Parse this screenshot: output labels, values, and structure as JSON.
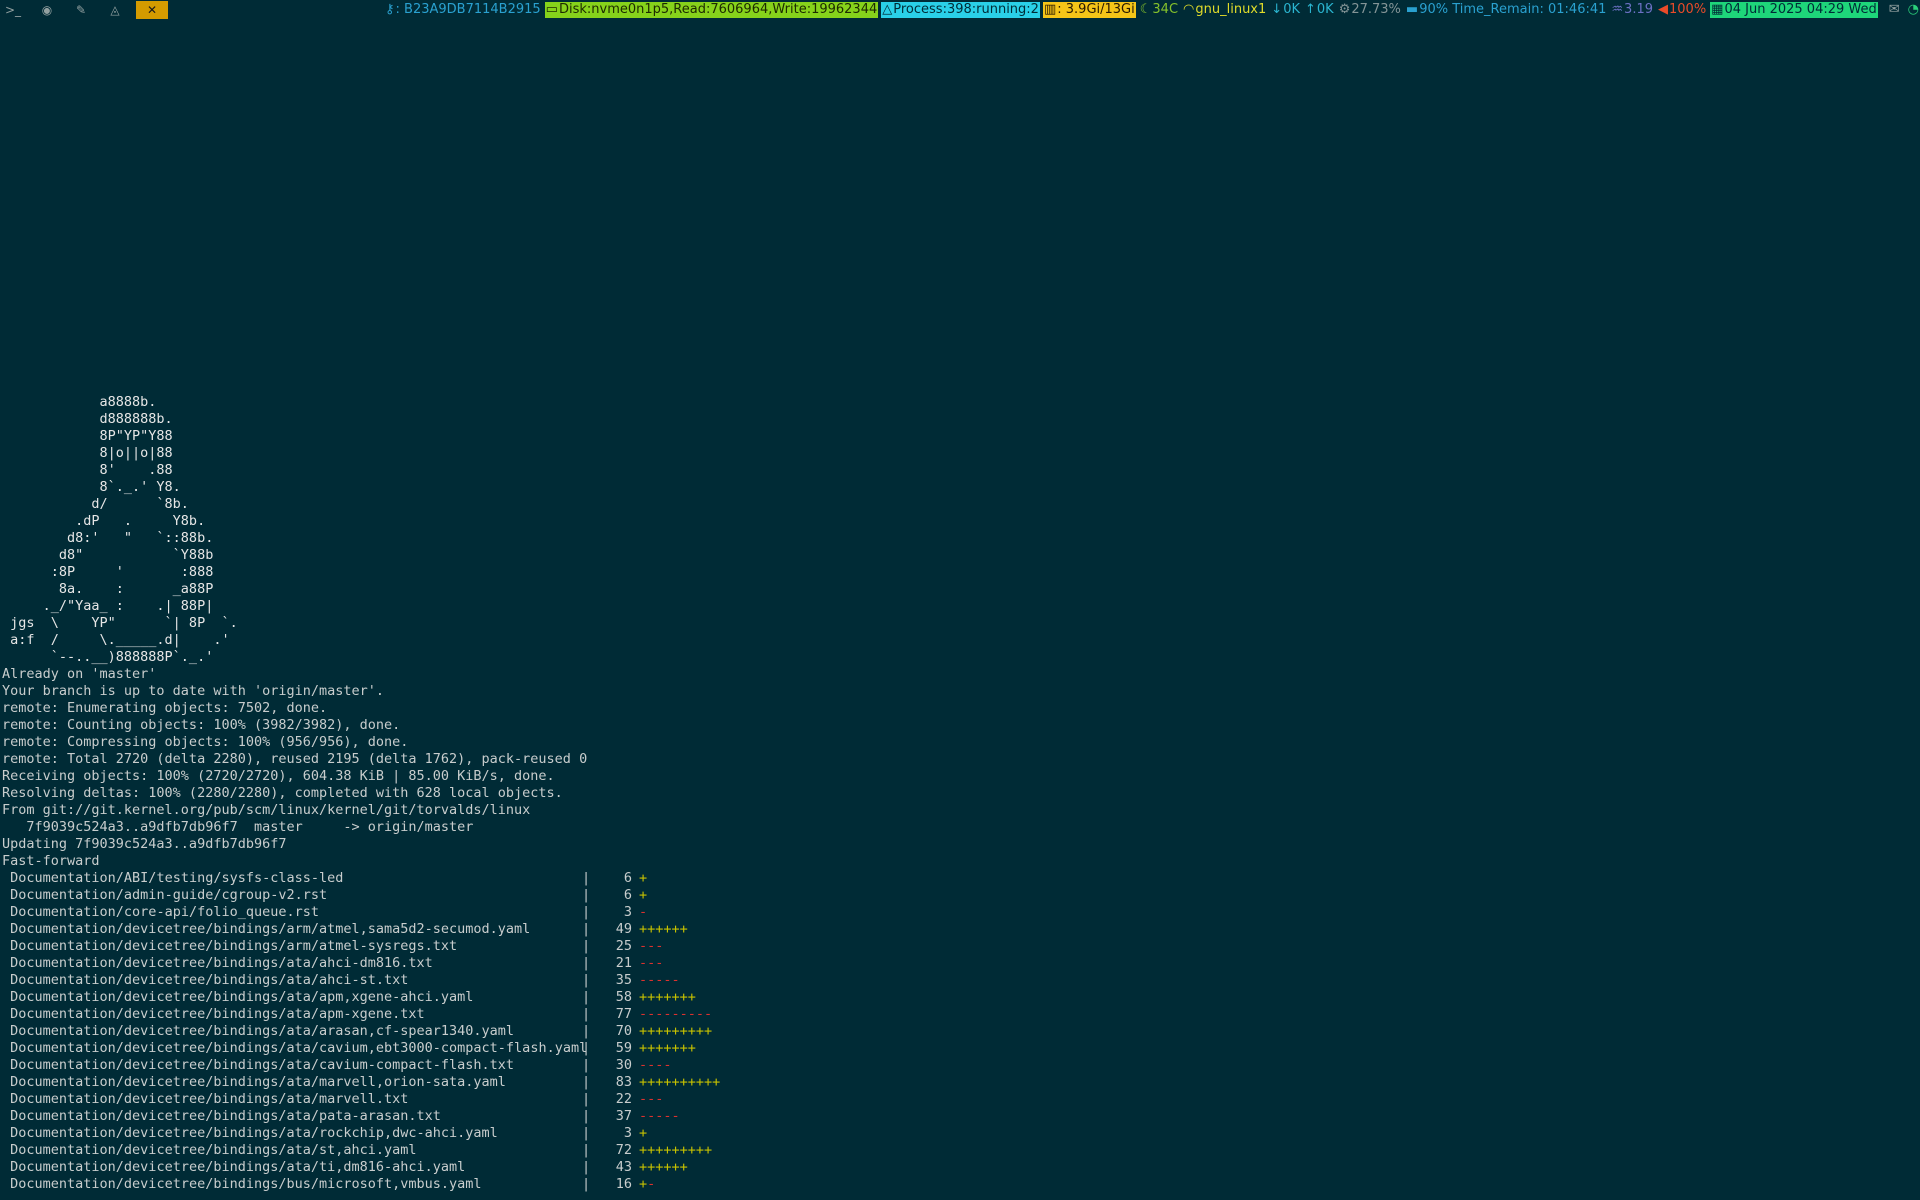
{
  "statusbar": {
    "tags": [
      {
        "name": "terminal-tag",
        "glyph": ">_"
      },
      {
        "name": "browser-tag",
        "glyph": "◉"
      },
      {
        "name": "editor-tag",
        "glyph": "✎"
      },
      {
        "name": "linux-tag",
        "glyph": "◬"
      },
      {
        "name": "tools-tag",
        "glyph": "✕"
      }
    ],
    "key": "B23A9DB7114B2915",
    "disk": "Disk:nvme0n1p5,Read:7606964,Write:19962344",
    "process": "Process:398:running:2",
    "memory": ": 3.9Gi/13Gi",
    "temperature": "34C",
    "network": "gnu_linux1",
    "net_down": "0K",
    "net_up": "0K",
    "cpu": "27.73%",
    "battery": "90% Time_Remain: 01:46:41",
    "load": "3.19",
    "volume": "100%",
    "date": "04 Jun 2025 04:29 Wed",
    "colors": {
      "bg": "#002b36",
      "disk": "#86d21b",
      "process": "#2ad0e8",
      "memory": "#f5c518",
      "date": "#1ed67a",
      "active_tag": "#d49b00"
    }
  },
  "terminal": {
    "ascii_art": [
      "            a8888b.",
      "            d888888b.",
      "            8P\"YP\"Y88",
      "            8|o||o|88",
      "            8'    .88",
      "            8`._.' Y8.",
      "           d/      `8b.",
      "         .dP   .     Y8b.",
      "        d8:'   \"   `::88b.",
      "       d8\"           `Y88b",
      "      :8P     '       :888",
      "       8a.    :      _a88P",
      "     ._/\"Yaa_ :    .| 88P|",
      " jgs  \\    YP\"      `| 8P  `.",
      " a:f  /     \\._____.d|    .'",
      "      `--..__)888888P`._.'"
    ],
    "output": [
      "Already on 'master'",
      "Your branch is up to date with 'origin/master'.",
      "remote: Enumerating objects: 7502, done.",
      "remote: Counting objects: 100% (3982/3982), done.",
      "remote: Compressing objects: 100% (956/956), done.",
      "remote: Total 2720 (delta 2280), reused 2195 (delta 1762), pack-reused 0",
      "Receiving objects: 100% (2720/2720), 604.38 KiB | 85.00 KiB/s, done.",
      "Resolving deltas: 100% (2280/2280), completed with 628 local objects.",
      "From git://git.kernel.org/pub/scm/linux/kernel/git/torvalds/linux",
      "   7f9039c524a3..a9dfb7db96f7  master     -> origin/master",
      "Updating 7f9039c524a3..a9dfb7db96f7",
      "Fast-forward"
    ],
    "diffstat": [
      {
        "path": "Documentation/ABI/testing/sysfs-class-led",
        "count": "6",
        "plus": "+",
        "minus": ""
      },
      {
        "path": "Documentation/admin-guide/cgroup-v2.rst",
        "count": "6",
        "plus": "+",
        "minus": ""
      },
      {
        "path": "Documentation/core-api/folio_queue.rst",
        "count": "3",
        "plus": "",
        "minus": "-"
      },
      {
        "path": "Documentation/devicetree/bindings/arm/atmel,sama5d2-secumod.yaml",
        "count": "49",
        "plus": "++++++",
        "minus": ""
      },
      {
        "path": "Documentation/devicetree/bindings/arm/atmel-sysregs.txt",
        "count": "25",
        "plus": "",
        "minus": "---"
      },
      {
        "path": "Documentation/devicetree/bindings/ata/ahci-dm816.txt",
        "count": "21",
        "plus": "",
        "minus": "---"
      },
      {
        "path": "Documentation/devicetree/bindings/ata/ahci-st.txt",
        "count": "35",
        "plus": "",
        "minus": "-----"
      },
      {
        "path": "Documentation/devicetree/bindings/ata/apm,xgene-ahci.yaml",
        "count": "58",
        "plus": "+++++++",
        "minus": ""
      },
      {
        "path": "Documentation/devicetree/bindings/ata/apm-xgene.txt",
        "count": "77",
        "plus": "",
        "minus": "---------"
      },
      {
        "path": "Documentation/devicetree/bindings/ata/arasan,cf-spear1340.yaml",
        "count": "70",
        "plus": "+++++++++",
        "minus": ""
      },
      {
        "path": "Documentation/devicetree/bindings/ata/cavium,ebt3000-compact-flash.yaml",
        "count": "59",
        "plus": "+++++++",
        "minus": ""
      },
      {
        "path": "Documentation/devicetree/bindings/ata/cavium-compact-flash.txt",
        "count": "30",
        "plus": "",
        "minus": "----"
      },
      {
        "path": "Documentation/devicetree/bindings/ata/marvell,orion-sata.yaml",
        "count": "83",
        "plus": "++++++++++",
        "minus": ""
      },
      {
        "path": "Documentation/devicetree/bindings/ata/marvell.txt",
        "count": "22",
        "plus": "",
        "minus": "---"
      },
      {
        "path": "Documentation/devicetree/bindings/ata/pata-arasan.txt",
        "count": "37",
        "plus": "",
        "minus": "-----"
      },
      {
        "path": "Documentation/devicetree/bindings/ata/rockchip,dwc-ahci.yaml",
        "count": "3",
        "plus": "+",
        "minus": ""
      },
      {
        "path": "Documentation/devicetree/bindings/ata/st,ahci.yaml",
        "count": "72",
        "plus": "+++++++++",
        "minus": ""
      },
      {
        "path": "Documentation/devicetree/bindings/ata/ti,dm816-ahci.yaml",
        "count": "43",
        "plus": "++++++",
        "minus": ""
      },
      {
        "path": "Documentation/devicetree/bindings/bus/microsoft,vmbus.yaml",
        "count": "16",
        "plus": "+",
        "minus": "-"
      }
    ]
  }
}
